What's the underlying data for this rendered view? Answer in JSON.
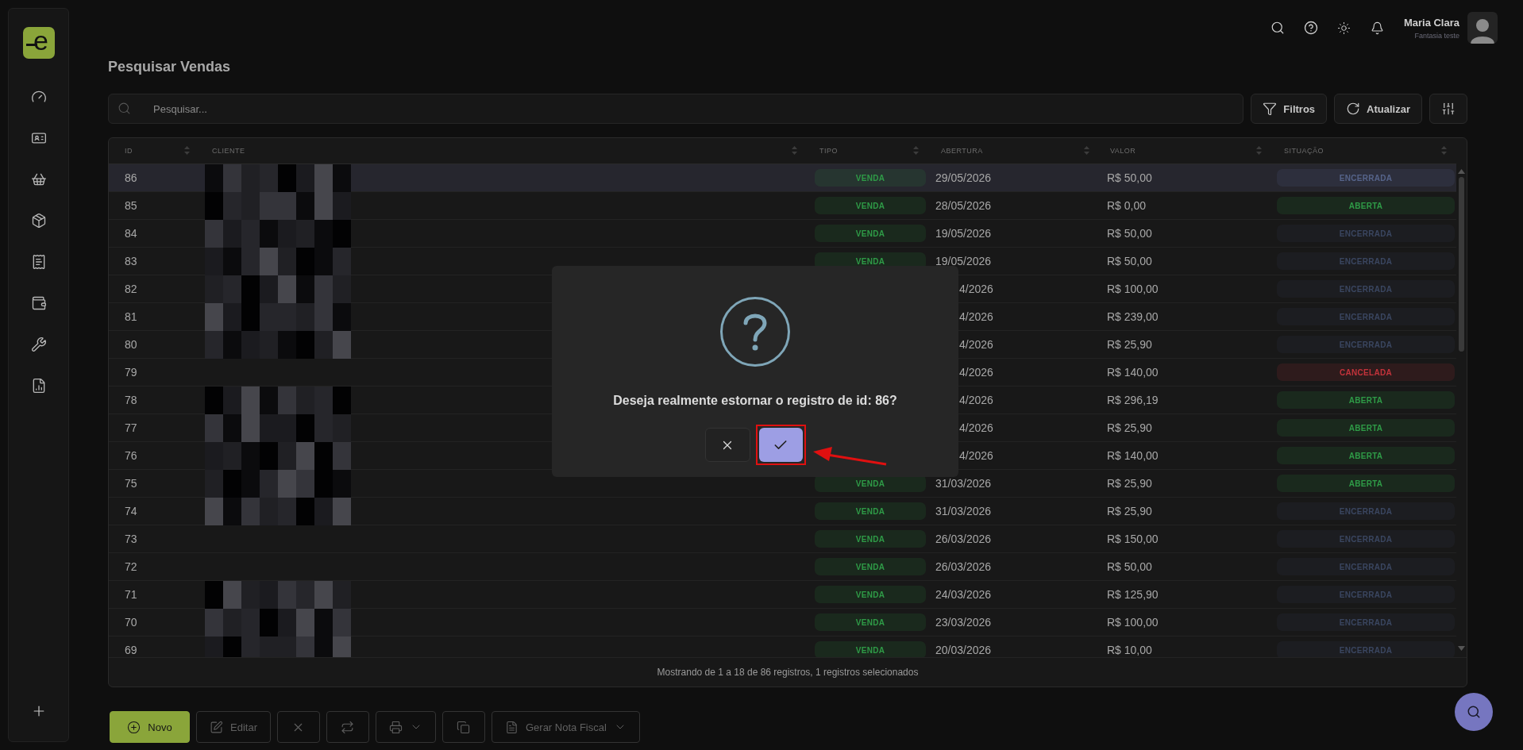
{
  "logo": {
    "text": "e"
  },
  "sidebar": {
    "items": [
      {
        "kind": "dashboard"
      },
      {
        "kind": "contacts"
      },
      {
        "kind": "sales"
      },
      {
        "kind": "products"
      },
      {
        "kind": "finance"
      },
      {
        "kind": "money"
      },
      {
        "kind": "services"
      },
      {
        "kind": "reports"
      }
    ]
  },
  "header": {
    "user_name": "Maria Clara",
    "company": "Fantasia teste"
  },
  "page_title": "Pesquisar Vendas",
  "search": {
    "placeholder": "Pesquisar..."
  },
  "actions": [
    {
      "kind": "filter",
      "label": "Filtros"
    },
    {
      "kind": "refresh",
      "label": "Atualizar"
    },
    {
      "kind": "columns"
    }
  ],
  "table": {
    "columns": [
      "ID",
      "CLIENTE",
      "TIPO",
      "ABERTURA",
      "VALOR",
      "SITUAÇÃO"
    ],
    "rows": [
      {
        "id": "86",
        "client_hidden": true,
        "type": "VENDA",
        "opened": "29/05/2026",
        "value": "R$ 50,00",
        "status": "ENCERRADA",
        "color": "#56648a",
        "selected": true
      },
      {
        "id": "85",
        "client_hidden": true,
        "type": "VENDA",
        "opened": "28/05/2026",
        "value": "R$ 0,00",
        "status": "ABERTA",
        "color": "#2f9b47",
        "selected": false
      },
      {
        "id": "84",
        "client_hidden": true,
        "type": "VENDA",
        "opened": "19/05/2026",
        "value": "R$ 50,00",
        "status": "ENCERRADA",
        "color": "#3a4660",
        "selected": false
      },
      {
        "id": "83",
        "client_hidden": true,
        "type": "VENDA",
        "opened": "19/05/2026",
        "value": "R$ 50,00",
        "status": "ENCERRADA",
        "color": "#3a4660",
        "selected": false
      },
      {
        "id": "82",
        "client_hidden": true,
        "opened": "4/2026",
        "value": "R$ 100,00",
        "status": "ENCERRADA",
        "color": "#3a4660",
        "selected": false
      },
      {
        "id": "81",
        "client_hidden": true,
        "opened": "4/2026",
        "value": "R$ 239,00",
        "status": "ENCERRADA",
        "color": "#3a4660",
        "selected": false
      },
      {
        "id": "80",
        "client_hidden": true,
        "opened": "4/2026",
        "value": "R$ 25,90",
        "status": "ENCERRADA",
        "color": "#3a4660",
        "selected": false
      },
      {
        "id": "79",
        "client_hidden": false,
        "opened": "4/2026",
        "value": "R$ 140,00",
        "status": "CANCELADA",
        "color": "#c3333b",
        "selected": false
      },
      {
        "id": "78",
        "client_hidden": true,
        "opened": "4/2026",
        "value": "R$ 296,19",
        "status": "ABERTA",
        "color": "#2f9b47",
        "selected": false
      },
      {
        "id": "77",
        "client_hidden": true,
        "opened": "4/2026",
        "value": "R$ 25,90",
        "status": "ABERTA",
        "color": "#2f9b47",
        "selected": false
      },
      {
        "id": "76",
        "client_hidden": true,
        "opened": "4/2026",
        "value": "R$ 140,00",
        "status": "ABERTA",
        "color": "#2f9b47",
        "selected": false
      },
      {
        "id": "75",
        "client_hidden": true,
        "type": "VENDA",
        "opened": "31/03/2026",
        "value": "R$ 25,90",
        "status": "ABERTA",
        "color": "#2f9b47",
        "selected": false
      },
      {
        "id": "74",
        "client_hidden": true,
        "type": "VENDA",
        "opened": "31/03/2026",
        "value": "R$ 25,90",
        "status": "ENCERRADA",
        "color": "#3a4660",
        "selected": false
      },
      {
        "id": "73",
        "client_hidden": false,
        "type": "VENDA",
        "opened": "26/03/2026",
        "value": "R$ 150,00",
        "status": "ENCERRADA",
        "color": "#3a4660",
        "selected": false
      },
      {
        "id": "72",
        "client_hidden": false,
        "type": "VENDA",
        "opened": "26/03/2026",
        "value": "R$ 50,00",
        "status": "ENCERRADA",
        "color": "#3a4660",
        "selected": false
      },
      {
        "id": "71",
        "client_hidden": true,
        "type": "VENDA",
        "opened": "24/03/2026",
        "value": "R$ 125,90",
        "status": "ENCERRADA",
        "color": "#3a4660",
        "selected": false
      },
      {
        "id": "70",
        "client_hidden": true,
        "type": "VENDA",
        "opened": "23/03/2026",
        "value": "R$ 100,00",
        "status": "ENCERRADA",
        "color": "#3a4660",
        "selected": false
      },
      {
        "id": "69",
        "client_hidden": true,
        "type": "VENDA",
        "opened": "20/03/2026",
        "value": "R$ 10,00",
        "status": "ENCERRADA",
        "color": "#3a4660",
        "selected": false
      }
    ],
    "footer": "Mostrando de 1 a 18 de 86 registros, 1 registros selecionados"
  },
  "toolbar": [
    {
      "kind": "new",
      "label": "Novo",
      "disabled": false
    },
    {
      "kind": "edit",
      "label": "Editar",
      "disabled": true
    },
    {
      "kind": "cancel",
      "disabled": true
    },
    {
      "kind": "swap",
      "disabled": true
    },
    {
      "kind": "print",
      "disabled": true
    },
    {
      "kind": "copy",
      "disabled": true
    },
    {
      "kind": "invoice",
      "label": "Gerar Nota Fiscal",
      "disabled": true
    }
  ],
  "dialog": {
    "message": "Deseja realmente estornar o registro de id: 86?",
    "confirm_highlighted": true
  }
}
